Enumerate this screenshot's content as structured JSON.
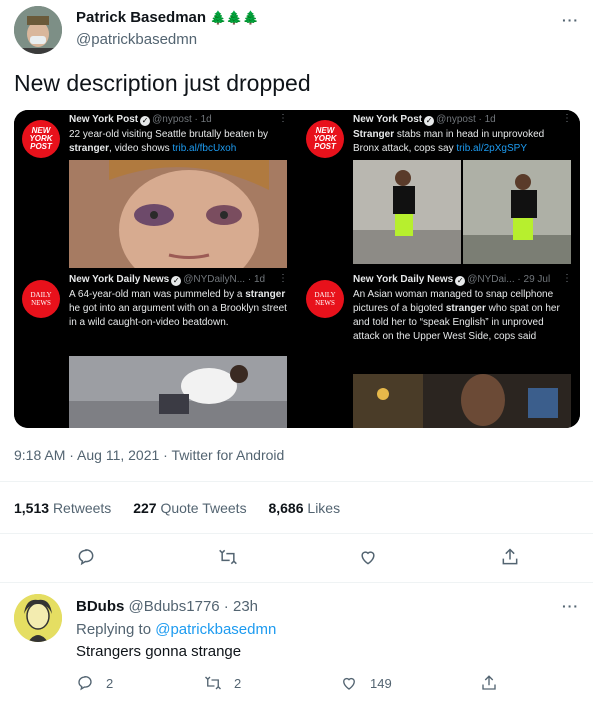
{
  "main_tweet": {
    "author_name": "Patrick Basedman",
    "author_emoji": "🌲🌲🌲",
    "handle": "@patrickbasedmn",
    "text": "New description just dropped",
    "timestamp": "9:18 AM · Aug 11, 2021 · Twitter for Android",
    "stats": {
      "retweets_count": "1,513",
      "retweets_label": "Retweets",
      "quotes_count": "227",
      "quotes_label": "Quote Tweets",
      "likes_count": "8,686",
      "likes_label": "Likes"
    }
  },
  "embedded": [
    {
      "logo_text": "NEW YORK POST",
      "source_name": "New York Post",
      "source_handle": "@nypost · 1d",
      "headline_pre": "22 year-old visiting Seattle brutally beaten by ",
      "headline_bold": "stranger",
      "headline_post": ", video shows ",
      "link": "trib.al/fbcUxoh"
    },
    {
      "logo_text": "NEW YORK POST",
      "source_name": "New York Post",
      "source_handle": "@nypost · 1d",
      "headline_pre": "",
      "headline_bold": "Stranger",
      "headline_post": " stabs man in head in unprovoked Bronx attack, cops say ",
      "link": "trib.al/2pXgSPY"
    },
    {
      "logo_text": "DAILY NEWS",
      "source_name": "New York Daily News",
      "source_handle": "@NYDailyN... · 1d",
      "headline_pre": "A 64-year-old man was pummeled by a ",
      "headline_bold": "stranger",
      "headline_post": " he got into an argument with on a Brooklyn street in a wild caught-on-video beatdown.",
      "link": ""
    },
    {
      "logo_text": "DAILY NEWS",
      "source_name": "New York Daily News",
      "source_handle": "@NYDai... · 29 Jul",
      "headline_pre": "An Asian woman managed to snap cellphone pictures of a bigoted ",
      "headline_bold": "stranger",
      "headline_post": " who spat on her and told her to “speak English” in unproved attack on the Upper West Side, cops said",
      "link": ""
    }
  ],
  "reply": {
    "author_name": "BDubs",
    "handle_time": "@Bdubs1776 · 23h",
    "replying_label": "Replying to ",
    "replying_handle": "@patrickbasedmn",
    "text": "Strangers gonna strange",
    "reply_count": "2",
    "retweet_count": "2",
    "like_count": "149"
  },
  "icons": [
    "reply-icon",
    "retweet-icon",
    "like-icon",
    "share-icon",
    "verified-icon",
    "more-icon"
  ],
  "colors": {
    "accent": "#1d9bf0",
    "muted": "#536471",
    "brand_red": "#e8111b"
  }
}
